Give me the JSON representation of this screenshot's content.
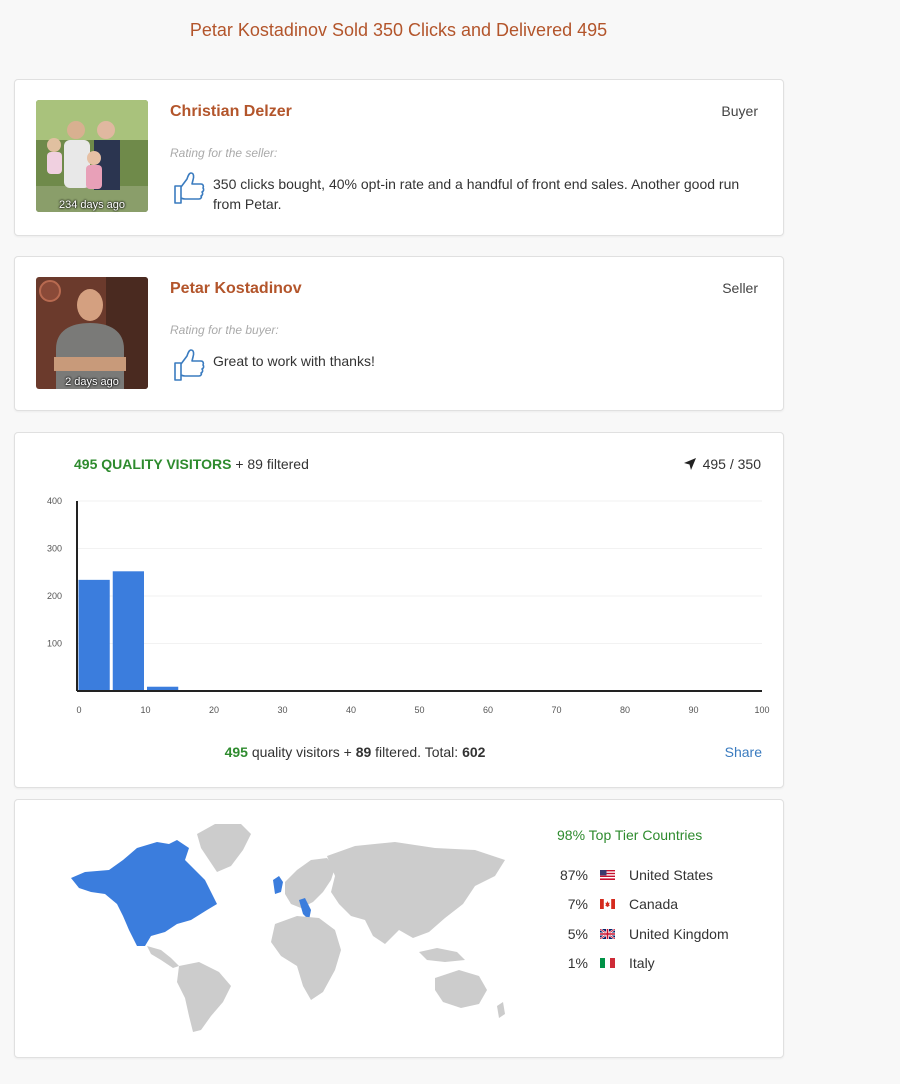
{
  "page": {
    "title": "Petar Kostadinov Sold 350 Clicks and Delivered 495"
  },
  "reviews": [
    {
      "name": "Christian Delzer",
      "role": "Buyer",
      "time": "234 days ago",
      "rating_label": "Rating for the seller:",
      "text": "350 clicks bought, 40% opt-in rate and a handful of front end sales. Another good run from Petar."
    },
    {
      "name": "Petar Kostadinov",
      "role": "Seller",
      "time": "2 days ago",
      "rating_label": "Rating for the buyer:",
      "text": "Great to work with thanks!"
    }
  ],
  "visitors": {
    "quality_label": "495 QUALITY VISITORS",
    "filtered_label": "+ 89 filtered",
    "ratio": "495 / 350",
    "footer": {
      "quality": "495",
      "quality_text": "quality visitors +",
      "filtered": "89",
      "filtered_text": "filtered. Total:",
      "total": "602"
    },
    "share_label": "Share"
  },
  "chart_data": {
    "type": "bar",
    "x": [
      5,
      10,
      15,
      20,
      25,
      30,
      35,
      40,
      45,
      50,
      55,
      60,
      65,
      70,
      75,
      80,
      85,
      90,
      95,
      100
    ],
    "values": [
      234,
      252,
      9,
      0,
      0,
      0,
      0,
      0,
      0,
      0,
      0,
      0,
      0,
      0,
      0,
      0,
      0,
      0,
      0,
      0
    ],
    "xlim": [
      0,
      100
    ],
    "ylim": [
      0,
      400
    ],
    "xticks": [
      "0",
      "10",
      "20",
      "30",
      "40",
      "50",
      "60",
      "70",
      "80",
      "90",
      "100"
    ],
    "yticks": [
      "100",
      "200",
      "300",
      "400"
    ],
    "bar_color": "#3b7ddd",
    "grid": true
  },
  "map": {
    "tier_title": "98% Top Tier Countries",
    "countries": [
      {
        "pct": "87%",
        "name": "United States",
        "flag": "us-flag-icon"
      },
      {
        "pct": "7%",
        "name": "Canada",
        "flag": "canada-flag-icon"
      },
      {
        "pct": "5%",
        "name": "United Kingdom",
        "flag": "uk-flag-icon"
      },
      {
        "pct": "1%",
        "name": "Italy",
        "flag": "italy-flag-icon"
      }
    ],
    "highlight_color": "#3b7ddd",
    "base_color": "#cccccc"
  }
}
